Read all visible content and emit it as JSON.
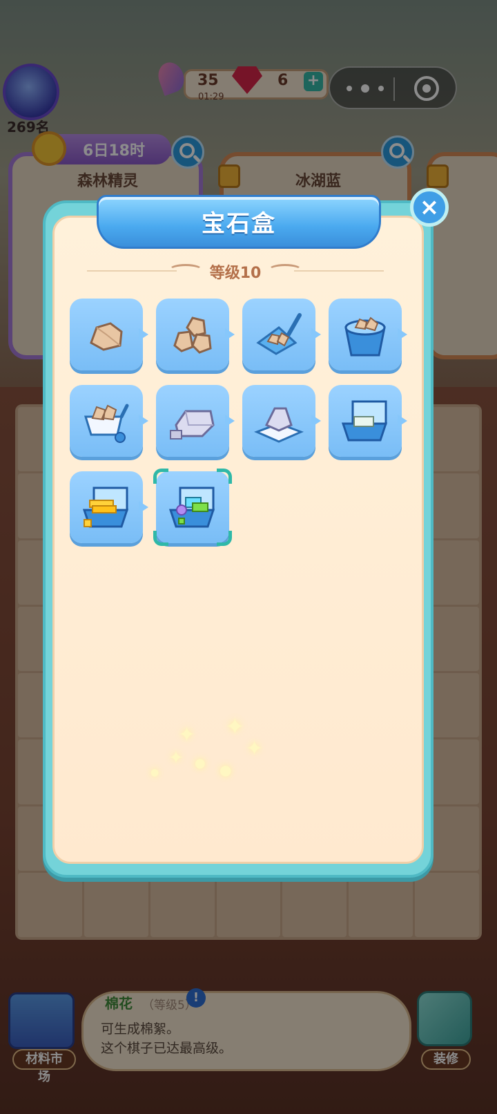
{
  "hud": {
    "rank": "269名",
    "event_timer": "6日18时",
    "feather_count": "35",
    "feather_timer": "01:29",
    "gem_count": "6",
    "plus_label": "+"
  },
  "cards": [
    {
      "title": "森林精灵"
    },
    {
      "title": "冰湖蓝"
    }
  ],
  "modal": {
    "title": "宝石盒",
    "level": "等级10",
    "close_label": "×",
    "items": [
      {
        "icon": "small-rock-icon"
      },
      {
        "icon": "rock-pile-icon"
      },
      {
        "icon": "ore-scoop-icon"
      },
      {
        "icon": "ore-bucket-icon"
      },
      {
        "icon": "ore-cart-icon"
      },
      {
        "icon": "silver-ingot-icon"
      },
      {
        "icon": "silver-ingot-stack-icon"
      },
      {
        "icon": "silver-ingot-case-icon"
      },
      {
        "icon": "gold-bar-case-icon"
      },
      {
        "icon": "gem-box-icon",
        "selected": true
      }
    ]
  },
  "bottom": {
    "item_name": "棉花",
    "item_level": "（等级5）",
    "alert": "!",
    "line1": "可生成棉絮。",
    "line2": "这个棋子已达最高级。",
    "market_label": "材料市场",
    "decorate_label": "装修"
  },
  "colors": {
    "modal_frame": "#74d3d9",
    "modal_panel": "#fff1da",
    "title_ribbon": "#4aa9ef",
    "item_tile": "#8ccafc",
    "selection": "#2fb8a8"
  }
}
